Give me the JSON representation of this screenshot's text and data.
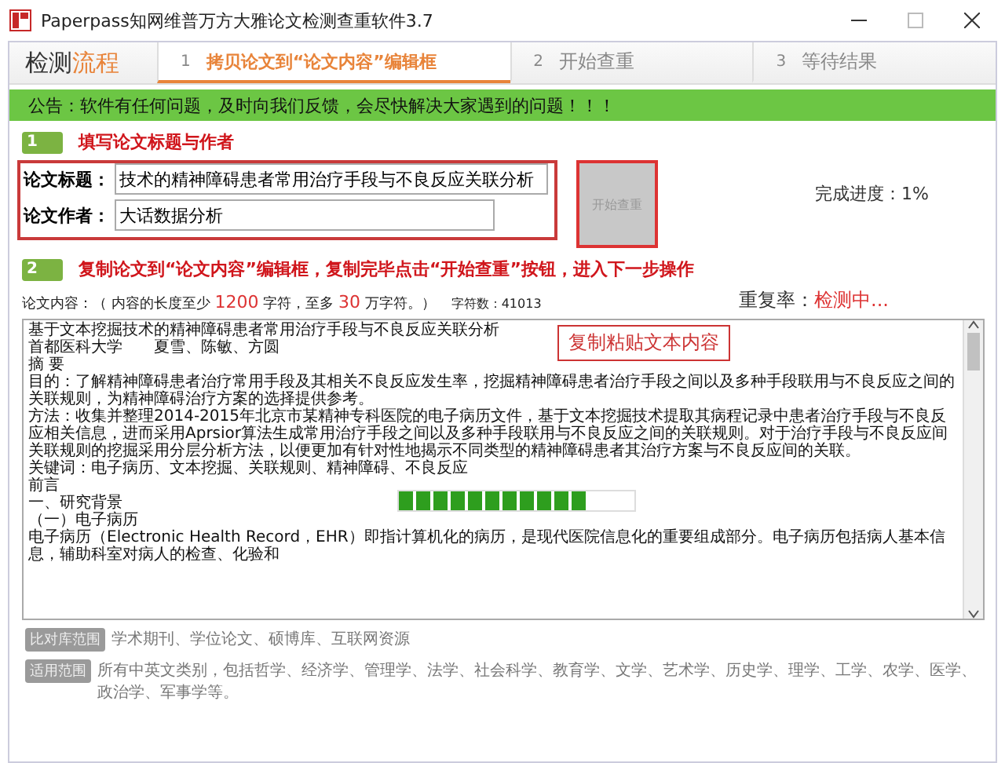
{
  "window": {
    "title": "Paperpass知网维普万方大雅论文检测查重软件3.7"
  },
  "steps_header": {
    "title_main": "检测",
    "title_accent": "流程"
  },
  "steps": [
    {
      "number": "1",
      "label": "拷贝论文到“论文内容”编辑框",
      "selected": true
    },
    {
      "number": "2",
      "label": "开始查重",
      "selected": false
    },
    {
      "number": "3",
      "label": "等待结果",
      "selected": false
    }
  ],
  "notice": "公告：软件有任何问题，及时向我们反馈，会尽快解决大家遇到的问题！！！",
  "section_1": {
    "badge": "1",
    "title": "填写论文标题与作者"
  },
  "form": {
    "title_label": "论文标题：",
    "title_value": "技术的精神障碍患者常用治疗手段与不良反应关联分析",
    "author_label": "论文作者：",
    "author_value": "大话数据分析"
  },
  "start_button": {
    "label": "开始查重",
    "disabled": true
  },
  "progress": {
    "label": "完成进度：",
    "value": "1%"
  },
  "section_2": {
    "badge": "2",
    "title": "复制论文到“论文内容”编辑框，复制完毕点击“开始查重”按钮，进入下一步操作"
  },
  "content_info": {
    "prefix": "论文内容：（ 内容的长度至少 ",
    "min": "1200",
    "middle": " 字符，至多 ",
    "max": "30",
    "suffix": " 万字符。）",
    "count_label": "字符数：41013"
  },
  "repeat_rate": {
    "label": "重复率：",
    "value": "检测中..."
  },
  "editor": {
    "hint": "复制粘贴文本内容",
    "loading": {
      "level": 0.8
    },
    "lines": [
      "基于文本挖掘技术的精神障碍患者常用治疗手段与不良反应关联分析",
      "首都医科大学　　夏雪、陈敏、方圆",
      "摘 要",
      "目的：了解精神障碍患者治疗常用手段及其相关不良反应发生率，挖掘精神障碍患者治疗手段之间以及多种手段联用与不良反应之间的关联规则，为精神障碍治疗方案的选择提供参考。",
      "方法：收集并整理2014-2015年北京市某精神专科医院的电子病历文件，基于文本挖掘技术提取其病程记录中患者治疗手段与不良反应相关信息，进而采用Aprsior算法生成常用治疗手段之间以及多种手段联用与不良反应之间的关联规则。对于治疗手段与不良反应间关联规则的挖掘采用分层分析方法，以便更加有针对性地揭示不同类型的精神障碍患者其治疗方案与不良反应间的关联。",
      "关键词：电子病历、文本挖掘、关联规则、精神障碍、不良反应",
      "前言",
      "一、研究背景",
      "（一）电子病历",
      "电子病历（Electronic Health Record，EHR）即指计算机化的病历，是现代医院信息化的重要组成部分。电子病历包括病人基本信息，辅助科室对病人的检查、化验和"
    ]
  },
  "footer": [
    {
      "tag": "比对库范围",
      "text": "学术期刊、学位论文、硕博库、互联网资源"
    },
    {
      "tag": "适用范围",
      "text": "所有中英文类别，包括哲学、经济学、管理学、法学、社会科学、教育学、文学、艺术学、历史学、理学、工学、农学、医学、政治学、军事学等。"
    }
  ]
}
